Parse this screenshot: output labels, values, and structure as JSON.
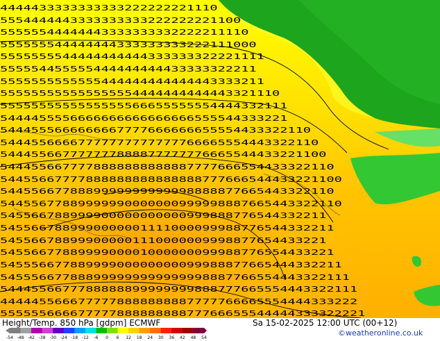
{
  "header": {
    "title": "Height/Temp. 850 hPa [gdpm] ECMWF",
    "run": "Sa 15-02-2025 12:00 UTC (00+12)",
    "credit": "©weatheronline.co.uk"
  },
  "colorbar": {
    "labels": [
      "-54",
      "-48",
      "-42",
      "-38",
      "-30",
      "-24",
      "-18",
      "-12",
      "-6",
      "0",
      "6",
      "12",
      "18",
      "24",
      "30",
      "36",
      "42",
      "48",
      "54"
    ],
    "colors": [
      "#7f7f7f",
      "#a0a0a0",
      "#b000b0",
      "#d040d0",
      "#6000c0",
      "#2040ff",
      "#00a0ff",
      "#00e0e0",
      "#00c000",
      "#80e000",
      "#ffff00",
      "#ffd000",
      "#ffa000",
      "#ff7000",
      "#ff2000",
      "#d00000",
      "#a00000",
      "#800040"
    ]
  },
  "map": {
    "field_colors": {
      "cold_green": "#1ea51e",
      "mid_green": "#33c833",
      "light_green": "#66e066",
      "yellow": "#ffff00",
      "yellow_warm": "#ffe000",
      "orange_light": "#ffc400",
      "orange": "#ffa800"
    },
    "digit_rows": [
      "4444433333333333222222221110",
      "5554444443333333333222222221100",
      "55555544444443333333332222211110",
      "555555544444444333333333222111000",
      "5555555544444444444333333322221111",
      "555554455555444444444433333322211",
      "5555555555555444444444444443333211",
      "555555555555555554444444444443321110",
      "5555555555555555566655555554444332111",
      "5444455556666666666666666555544333221",
      "5444555666666667777666666655554433322110",
      "54445566667777777777777766665554443322110",
      "544455667777777888877777776665544433221100",
      "5444556677778888888888887777666554433322110",
      "54455667777888888888888888777666544433221100",
      "5445566778889999999999998888877665443322110",
      "54455677889999990000000999998887665443322110",
      "545566788999900000000000999888776544332211",
      "5455667889990000001111000099988776544332211",
      "545566788999000001110000009998877654433221",
      "5455667788999900001000000099988776554433221",
      "54555667788999900000000099988877665444332211",
      "545556677888999999999999998887766554443322111",
      "5444556677788888899999999888777665554443322111",
      "4444455666777778888888887777766665554444333222",
      "55555566667777788888888877766655544444333322221"
    ]
  }
}
